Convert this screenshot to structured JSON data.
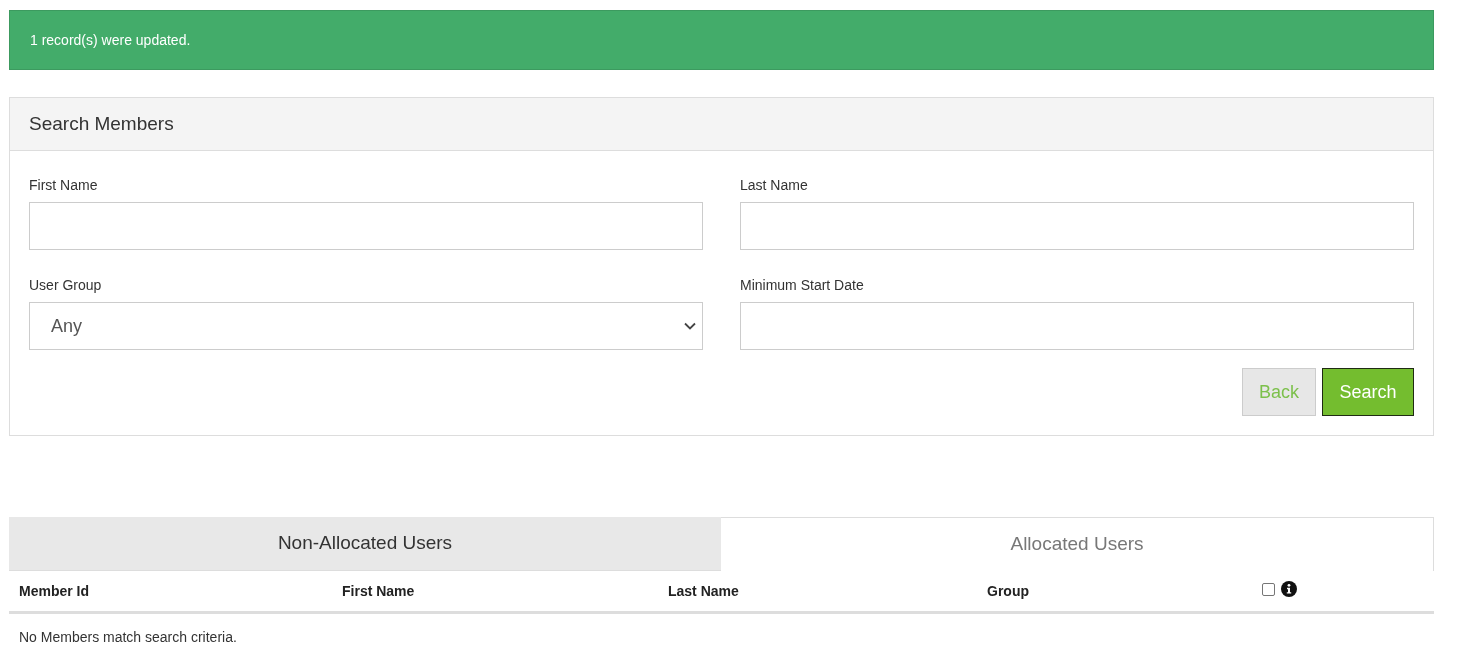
{
  "alert": {
    "message": "1 record(s) were updated."
  },
  "search_panel": {
    "title": "Search Members",
    "fields": [
      {
        "kind": "text",
        "label": "First Name"
      },
      {
        "kind": "text",
        "label": "Last Name"
      },
      {
        "kind": "select",
        "label": "User Group",
        "value": "Any"
      },
      {
        "kind": "text",
        "label": "Minimum Start Date"
      }
    ],
    "buttons": [
      {
        "kind": "secondary",
        "label": "Back"
      },
      {
        "kind": "primary",
        "label": "Search"
      }
    ]
  },
  "tabs": [
    {
      "label": "Non-Allocated Users",
      "selected": true
    },
    {
      "label": "Allocated Users",
      "selected": false
    }
  ],
  "table": {
    "columns": [
      "Member Id",
      "First Name",
      "Last Name",
      "Group"
    ],
    "select_all": {
      "checked": false
    },
    "empty_message": "No Members match search criteria."
  }
}
